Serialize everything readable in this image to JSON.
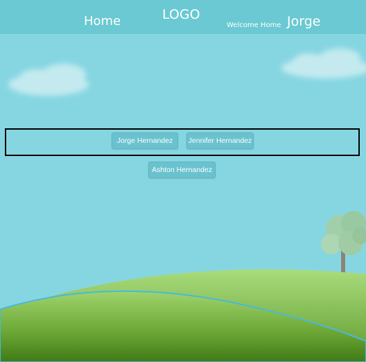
{
  "nav": {
    "home_label": "Home",
    "logo_label": "LOGO",
    "welcome_text": "Welcome Home",
    "user_name": "Jorge"
  },
  "people": [
    {
      "label": "Jorge Hernandez"
    },
    {
      "label": "Jennifer Hernandez"
    },
    {
      "label": "Ashton Hernandez"
    }
  ],
  "colors": {
    "sky": "#86d6e2",
    "nav": "#6ac9d2",
    "button": "#6ac2cf",
    "hill": "#7fbf4a"
  }
}
